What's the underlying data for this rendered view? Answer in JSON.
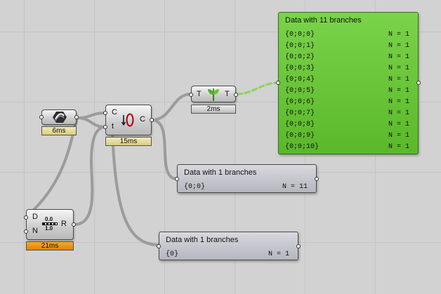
{
  "components": {
    "input_obj": {
      "timer": "6ms"
    },
    "split_comp": {
      "input_c": "C",
      "input_t": "t",
      "output_c": "C",
      "timer": "15ms"
    },
    "tree_comp": {
      "input": "T",
      "output": "T",
      "timer": "2ms"
    },
    "domain_comp": {
      "input_d": "D",
      "input_n": "N",
      "output": "R",
      "icon_top": "0.0",
      "icon_bottom": "1.0",
      "timer": "21ms"
    }
  },
  "panels": {
    "green": {
      "title": "Data with 11 branches",
      "rows": [
        {
          "path": "{0;0;0}",
          "count": "N = 1"
        },
        {
          "path": "{0;0;1}",
          "count": "N = 1"
        },
        {
          "path": "{0;0;2}",
          "count": "N = 1"
        },
        {
          "path": "{0;0;3}",
          "count": "N = 1"
        },
        {
          "path": "{0;0;4}",
          "count": "N = 1"
        },
        {
          "path": "{0;0;5}",
          "count": "N = 1"
        },
        {
          "path": "{0;0;6}",
          "count": "N = 1"
        },
        {
          "path": "{0;0;7}",
          "count": "N = 1"
        },
        {
          "path": "{0;0;8}",
          "count": "N = 1"
        },
        {
          "path": "{0;0;9}",
          "count": "N = 1"
        },
        {
          "path": "{0;0;10}",
          "count": "N = 1"
        }
      ],
      "color": "#5fbb2e"
    },
    "middle": {
      "title": "Data with 1 branches",
      "path": "{0;0}",
      "count": "N = 11"
    },
    "bottom": {
      "title": "Data with 1 branches",
      "path": "{0}",
      "count": "N = 1"
    }
  },
  "colors": {
    "canvas": "#d2d2d2",
    "wire": "#8a8a8a",
    "selected_wire": "#8fd35a",
    "timer_warn": "#f29a16"
  }
}
